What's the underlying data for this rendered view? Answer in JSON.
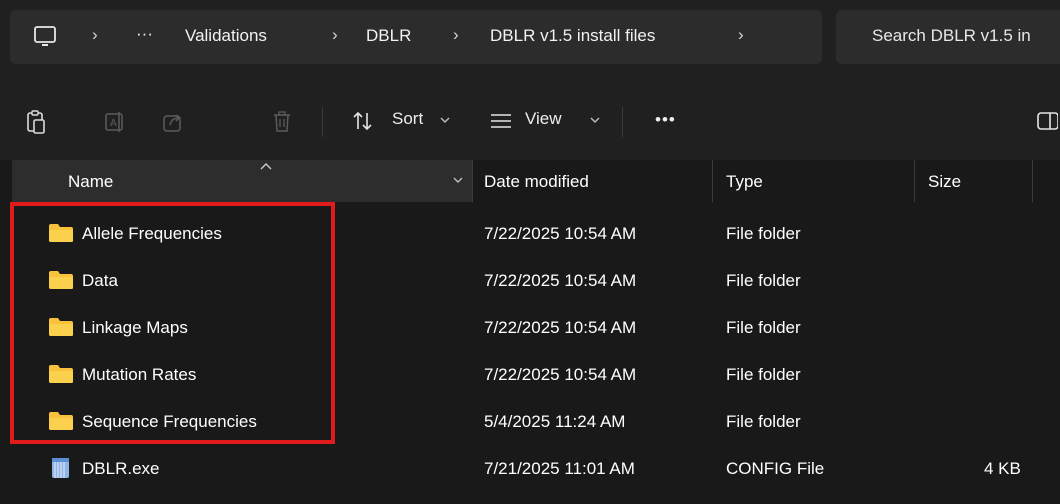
{
  "address_bar": {
    "breadcrumbs": [
      "Validations",
      "DBLR",
      "DBLR v1.5 install files"
    ],
    "overflow": "···",
    "separator": "›"
  },
  "search": {
    "placeholder": "Search DBLR v1.5 in"
  },
  "command_bar": {
    "sort_label": "Sort",
    "view_label": "View",
    "more_label": "•••"
  },
  "columns": {
    "name": "Name",
    "date": "Date modified",
    "type": "Type",
    "size": "Size"
  },
  "files": [
    {
      "name": "Allele Frequencies",
      "date": "7/22/2025 10:54 AM",
      "type": "File folder",
      "size": "",
      "icon": "folder-icon"
    },
    {
      "name": "Data",
      "date": "7/22/2025 10:54 AM",
      "type": "File folder",
      "size": "",
      "icon": "folder-icon"
    },
    {
      "name": "Linkage Maps",
      "date": "7/22/2025 10:54 AM",
      "type": "File folder",
      "size": "",
      "icon": "folder-icon"
    },
    {
      "name": "Mutation Rates",
      "date": "7/22/2025 10:54 AM",
      "type": "File folder",
      "size": "",
      "icon": "folder-icon"
    },
    {
      "name": "Sequence Frequencies",
      "date": "5/4/2025 11:24 AM",
      "type": "File folder",
      "size": "",
      "icon": "folder-icon"
    },
    {
      "name": "DBLR.exe",
      "date": "7/21/2025 11:01 AM",
      "type": "CONFIG File",
      "size": "4 KB",
      "icon": "config-file-icon"
    }
  ],
  "colors": {
    "highlight": "#e01b1b",
    "folder": "#f8c33a",
    "background": "#191919"
  }
}
